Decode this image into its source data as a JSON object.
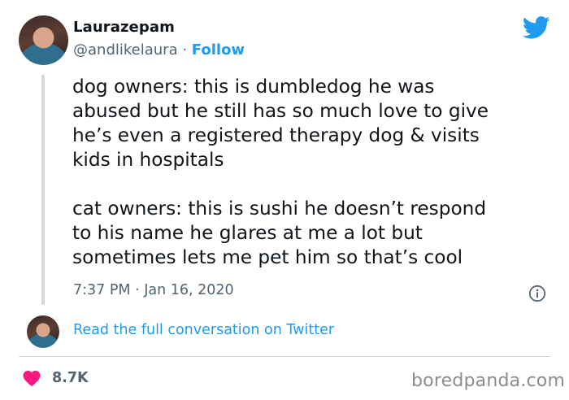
{
  "author": {
    "display_name": "Laurazepam",
    "handle": "@andlikelaura",
    "separator": "·",
    "follow_label": "Follow"
  },
  "tweet": {
    "paragraphs": [
      "dog owners: this is dumbledog he was\nabused but he still has so much love to give\nhe’s even a registered therapy dog & visits\nkids in hospitals",
      "cat owners: this is sushi he doesn’t respond\nto his name he glares at me a lot but\nsometimes lets me pet him so that’s cool"
    ],
    "timestamp": "7:37 PM · Jan 16, 2020"
  },
  "conversation_link": "Read the full conversation on Twitter",
  "likes": "8.7K",
  "watermark": "boredpanda.com",
  "icons": {
    "brand": "twitter-bird-icon",
    "info": "info-icon",
    "like": "heart-icon"
  },
  "colors": {
    "link": "#1d9bf0",
    "heart": "#f91880",
    "muted": "#536471",
    "text": "#0f1419"
  }
}
